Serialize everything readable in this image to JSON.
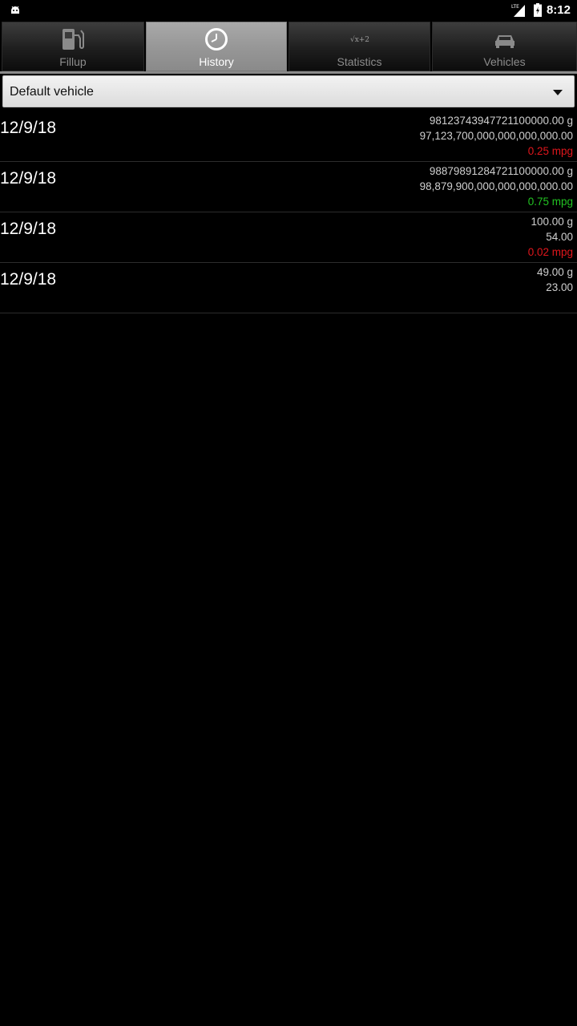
{
  "status": {
    "time": "8:12",
    "network": "LTE"
  },
  "tabs": [
    {
      "label": "Fillup",
      "icon": "fuel-pump-icon",
      "selected": false
    },
    {
      "label": "History",
      "icon": "clock-icon",
      "selected": true
    },
    {
      "label": "Statistics",
      "icon": "formula-icon",
      "icon_text": "√x+2",
      "selected": false
    },
    {
      "label": "Vehicles",
      "icon": "car-icon",
      "selected": false
    }
  ],
  "vehicle_select": {
    "value": "Default vehicle"
  },
  "history": [
    {
      "date": "12/9/18",
      "volume": "98123743947721100000.00 g",
      "cost": "97,123,700,000,000,000,000.00",
      "mpg": "0.25 mpg",
      "mpg_color": "#e0161c"
    },
    {
      "date": "12/9/18",
      "volume": "98879891284721100000.00 g",
      "cost": "98,879,900,000,000,000,000.00",
      "mpg": "0.75 mpg",
      "mpg_color": "#22c322"
    },
    {
      "date": "12/9/18",
      "volume": "100.00 g",
      "cost": "54.00",
      "mpg": "0.02 mpg",
      "mpg_color": "#e0161c"
    },
    {
      "date": "12/9/18",
      "volume": "49.00 g",
      "cost": "23.00",
      "mpg": ""
    }
  ]
}
